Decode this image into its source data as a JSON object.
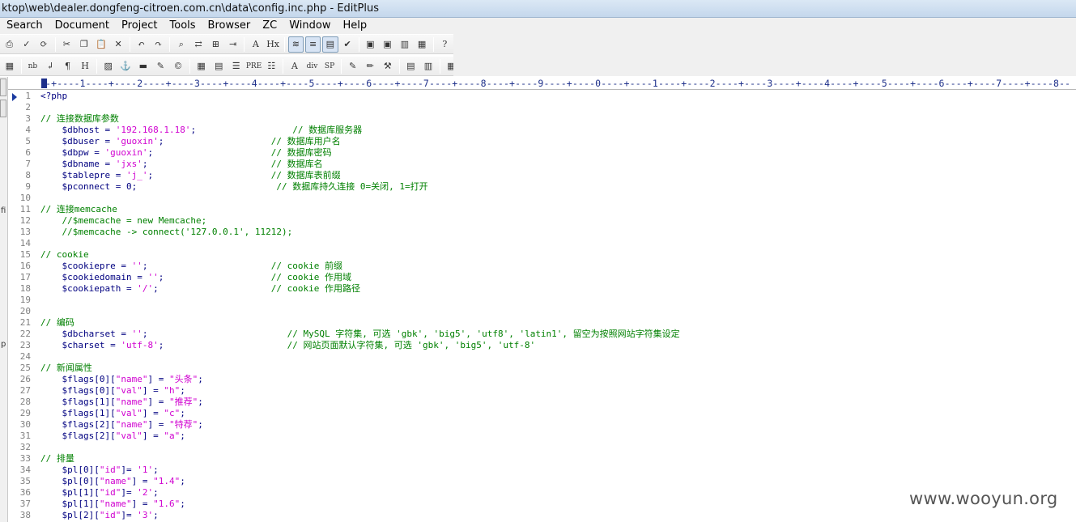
{
  "window": {
    "title": "ktop\\web\\dealer.dongfeng-citroen.com.cn\\data\\config.inc.php - EditPlus"
  },
  "menu": [
    "Search",
    "Document",
    "Project",
    "Tools",
    "Browser",
    "ZC",
    "Window",
    "Help"
  ],
  "toolbar1": [
    {
      "name": "print-icon",
      "glyph": "⎙"
    },
    {
      "name": "spellcheck-icon",
      "glyph": "✓"
    },
    {
      "name": "view-browser-icon",
      "glyph": "⟳"
    },
    {
      "name": "cut-icon",
      "glyph": "✂"
    },
    {
      "name": "copy-icon",
      "glyph": "❐"
    },
    {
      "name": "paste-icon",
      "glyph": "📋"
    },
    {
      "name": "delete-icon",
      "glyph": "✕"
    },
    {
      "name": "undo-icon",
      "glyph": "↶"
    },
    {
      "name": "redo-icon",
      "glyph": "↷"
    },
    {
      "name": "find-icon",
      "glyph": "⌕"
    },
    {
      "name": "replace-icon",
      "glyph": "⇄"
    },
    {
      "name": "find-in-files-icon",
      "glyph": "⊞"
    },
    {
      "name": "goto-icon",
      "glyph": "⇥"
    },
    {
      "name": "font-icon",
      "glyph": "A"
    },
    {
      "name": "hex-icon",
      "glyph": "Hx"
    },
    {
      "name": "word-wrap-icon",
      "glyph": "≋"
    },
    {
      "name": "line-number-icon",
      "glyph": "≡"
    },
    {
      "name": "ruler-icon",
      "glyph": "▤"
    },
    {
      "name": "check-icon",
      "glyph": "✔"
    },
    {
      "name": "window-icon",
      "glyph": "▣"
    },
    {
      "name": "window2-icon",
      "glyph": "▣"
    },
    {
      "name": "directory-icon",
      "glyph": "▥"
    },
    {
      "name": "cliptext-icon",
      "glyph": "▦"
    },
    {
      "name": "help-icon",
      "glyph": "?"
    }
  ],
  "toolbar2": [
    {
      "name": "color-icon",
      "glyph": "▦"
    },
    {
      "name": "nbsp-icon",
      "glyph": "nb"
    },
    {
      "name": "br-icon",
      "glyph": "↲"
    },
    {
      "name": "paragraph-icon",
      "glyph": "¶"
    },
    {
      "name": "heading-icon",
      "glyph": "H"
    },
    {
      "name": "image-icon",
      "glyph": "▨"
    },
    {
      "name": "anchor-icon",
      "glyph": "⚓"
    },
    {
      "name": "hr-icon",
      "glyph": "▬"
    },
    {
      "name": "highlight-icon",
      "glyph": "✎"
    },
    {
      "name": "copyright-icon",
      "glyph": "©"
    },
    {
      "name": "table-icon",
      "glyph": "▦"
    },
    {
      "name": "form-icon",
      "glyph": "▤"
    },
    {
      "name": "align-icon",
      "glyph": "☰"
    },
    {
      "name": "pre-icon",
      "glyph": "PRE"
    },
    {
      "name": "list-icon",
      "glyph": "☷"
    },
    {
      "name": "font-tag-icon",
      "glyph": "A"
    },
    {
      "name": "div-icon",
      "glyph": "div"
    },
    {
      "name": "span-icon",
      "glyph": "SP"
    },
    {
      "name": "edit-icon",
      "glyph": "✎"
    },
    {
      "name": "pencil-icon",
      "glyph": "✏"
    },
    {
      "name": "tools-icon",
      "glyph": "⚒"
    },
    {
      "name": "template-icon",
      "glyph": "▤"
    },
    {
      "name": "cliplib-icon",
      "glyph": "▥"
    },
    {
      "name": "palette-icon",
      "glyph": "▦"
    },
    {
      "name": "preview-icon",
      "glyph": "▣"
    }
  ],
  "ruler": "--+----1----+----2----+----3----+----4----+----5----+----6----+----7----+----8----+----9----+----0----+----1----+----2----+----3----+----4----+----5----+----6----+----7----+----8--",
  "code_lines": [
    {
      "n": "1",
      "parts": [
        {
          "t": "<?php",
          "c": "php"
        }
      ]
    },
    {
      "n": "2",
      "parts": []
    },
    {
      "n": "3",
      "parts": [
        {
          "t": "// 连接数据库参数",
          "c": "comment"
        }
      ]
    },
    {
      "n": "4",
      "parts": [
        {
          "t": "    $dbhost = ",
          "c": "var"
        },
        {
          "t": "'192.168.1.18'",
          "c": "str"
        },
        {
          "t": ";                  ",
          "c": "var"
        },
        {
          "t": "// 数据库服务器",
          "c": "comment"
        }
      ]
    },
    {
      "n": "5",
      "parts": [
        {
          "t": "    $dbuser = ",
          "c": "var"
        },
        {
          "t": "'guoxin'",
          "c": "str"
        },
        {
          "t": ";                    ",
          "c": "var"
        },
        {
          "t": "// 数据库用户名",
          "c": "comment"
        }
      ]
    },
    {
      "n": "6",
      "parts": [
        {
          "t": "    $dbpw = ",
          "c": "var"
        },
        {
          "t": "'guoxin'",
          "c": "str"
        },
        {
          "t": ";                      ",
          "c": "var"
        },
        {
          "t": "// 数据库密码",
          "c": "comment"
        }
      ]
    },
    {
      "n": "7",
      "parts": [
        {
          "t": "    $dbname = ",
          "c": "var"
        },
        {
          "t": "'jxs'",
          "c": "str"
        },
        {
          "t": ";                       ",
          "c": "var"
        },
        {
          "t": "// 数据库名",
          "c": "comment"
        }
      ]
    },
    {
      "n": "8",
      "parts": [
        {
          "t": "    $tablepre = ",
          "c": "var"
        },
        {
          "t": "'j_'",
          "c": "str"
        },
        {
          "t": ";                      ",
          "c": "var"
        },
        {
          "t": "// 数据库表前缀",
          "c": "comment"
        }
      ]
    },
    {
      "n": "9",
      "parts": [
        {
          "t": "    $pconnect = 0;                          ",
          "c": "var"
        },
        {
          "t": "// 数据库持久连接 0=关闭, 1=打开",
          "c": "comment"
        }
      ]
    },
    {
      "n": "10",
      "parts": []
    },
    {
      "n": "11",
      "parts": [
        {
          "t": "// 连接memcache",
          "c": "comment"
        }
      ]
    },
    {
      "n": "12",
      "parts": [
        {
          "t": "    //$memcache = new Memcache;",
          "c": "comment"
        }
      ]
    },
    {
      "n": "13",
      "parts": [
        {
          "t": "    //$memcache -> connect('127.0.0.1', 11212);",
          "c": "comment"
        }
      ]
    },
    {
      "n": "14",
      "parts": []
    },
    {
      "n": "15",
      "parts": [
        {
          "t": "// cookie",
          "c": "comment"
        }
      ]
    },
    {
      "n": "16",
      "parts": [
        {
          "t": "    $cookiepre = ",
          "c": "var"
        },
        {
          "t": "''",
          "c": "str"
        },
        {
          "t": ";                       ",
          "c": "var"
        },
        {
          "t": "// cookie 前缀",
          "c": "comment"
        }
      ]
    },
    {
      "n": "17",
      "parts": [
        {
          "t": "    $cookiedomain = ",
          "c": "var"
        },
        {
          "t": "''",
          "c": "str"
        },
        {
          "t": ";                    ",
          "c": "var"
        },
        {
          "t": "// cookie 作用域",
          "c": "comment"
        }
      ]
    },
    {
      "n": "18",
      "parts": [
        {
          "t": "    $cookiepath = ",
          "c": "var"
        },
        {
          "t": "'/'",
          "c": "str"
        },
        {
          "t": ";                     ",
          "c": "var"
        },
        {
          "t": "// cookie 作用路径",
          "c": "comment"
        }
      ]
    },
    {
      "n": "19",
      "parts": []
    },
    {
      "n": "20",
      "parts": []
    },
    {
      "n": "21",
      "parts": [
        {
          "t": "// 编码",
          "c": "comment"
        }
      ]
    },
    {
      "n": "22",
      "parts": [
        {
          "t": "    $dbcharset = ",
          "c": "var"
        },
        {
          "t": "''",
          "c": "str"
        },
        {
          "t": ";                          ",
          "c": "var"
        },
        {
          "t": "// MySQL 字符集, 可选 'gbk', 'big5', 'utf8', 'latin1', 留空为按照网站字符集设定",
          "c": "comment"
        }
      ]
    },
    {
      "n": "23",
      "parts": [
        {
          "t": "    $charset = ",
          "c": "var"
        },
        {
          "t": "'utf-8'",
          "c": "str"
        },
        {
          "t": ";                       ",
          "c": "var"
        },
        {
          "t": "// 网站页面默认字符集, 可选 'gbk', 'big5', 'utf-8'",
          "c": "comment"
        }
      ]
    },
    {
      "n": "24",
      "parts": []
    },
    {
      "n": "25",
      "parts": [
        {
          "t": "// 新闻属性",
          "c": "comment"
        }
      ]
    },
    {
      "n": "26",
      "parts": [
        {
          "t": "    $flags[0][",
          "c": "var"
        },
        {
          "t": "\"name\"",
          "c": "str"
        },
        {
          "t": "] = ",
          "c": "var"
        },
        {
          "t": "\"头条\"",
          "c": "str"
        },
        {
          "t": ";",
          "c": "var"
        }
      ]
    },
    {
      "n": "27",
      "parts": [
        {
          "t": "    $flags[0][",
          "c": "var"
        },
        {
          "t": "\"val\"",
          "c": "str"
        },
        {
          "t": "] = ",
          "c": "var"
        },
        {
          "t": "\"h\"",
          "c": "str"
        },
        {
          "t": ";",
          "c": "var"
        }
      ]
    },
    {
      "n": "28",
      "parts": [
        {
          "t": "    $flags[1][",
          "c": "var"
        },
        {
          "t": "\"name\"",
          "c": "str"
        },
        {
          "t": "] = ",
          "c": "var"
        },
        {
          "t": "\"推荐\"",
          "c": "str"
        },
        {
          "t": ";",
          "c": "var"
        }
      ]
    },
    {
      "n": "29",
      "parts": [
        {
          "t": "    $flags[1][",
          "c": "var"
        },
        {
          "t": "\"val\"",
          "c": "str"
        },
        {
          "t": "] = ",
          "c": "var"
        },
        {
          "t": "\"c\"",
          "c": "str"
        },
        {
          "t": ";",
          "c": "var"
        }
      ]
    },
    {
      "n": "30",
      "parts": [
        {
          "t": "    $flags[2][",
          "c": "var"
        },
        {
          "t": "\"name\"",
          "c": "str"
        },
        {
          "t": "] = ",
          "c": "var"
        },
        {
          "t": "\"特荐\"",
          "c": "str"
        },
        {
          "t": ";",
          "c": "var"
        }
      ]
    },
    {
      "n": "31",
      "parts": [
        {
          "t": "    $flags[2][",
          "c": "var"
        },
        {
          "t": "\"val\"",
          "c": "str"
        },
        {
          "t": "] = ",
          "c": "var"
        },
        {
          "t": "\"a\"",
          "c": "str"
        },
        {
          "t": ";",
          "c": "var"
        }
      ]
    },
    {
      "n": "32",
      "parts": []
    },
    {
      "n": "33",
      "parts": [
        {
          "t": "// 排量",
          "c": "comment"
        }
      ]
    },
    {
      "n": "34",
      "parts": [
        {
          "t": "    $pl[0][",
          "c": "var"
        },
        {
          "t": "\"id\"",
          "c": "str"
        },
        {
          "t": "]= ",
          "c": "var"
        },
        {
          "t": "'1'",
          "c": "str"
        },
        {
          "t": ";",
          "c": "var"
        }
      ]
    },
    {
      "n": "35",
      "parts": [
        {
          "t": "    $pl[0][",
          "c": "var"
        },
        {
          "t": "\"name\"",
          "c": "str"
        },
        {
          "t": "] = ",
          "c": "var"
        },
        {
          "t": "\"1.4\"",
          "c": "str"
        },
        {
          "t": ";",
          "c": "var"
        }
      ]
    },
    {
      "n": "36",
      "parts": [
        {
          "t": "    $pl[1][",
          "c": "var"
        },
        {
          "t": "\"id\"",
          "c": "str"
        },
        {
          "t": "]= ",
          "c": "var"
        },
        {
          "t": "'2'",
          "c": "str"
        },
        {
          "t": ";",
          "c": "var"
        }
      ]
    },
    {
      "n": "37",
      "parts": [
        {
          "t": "    $pl[1][",
          "c": "var"
        },
        {
          "t": "\"name\"",
          "c": "str"
        },
        {
          "t": "] = ",
          "c": "var"
        },
        {
          "t": "\"1.6\"",
          "c": "str"
        },
        {
          "t": ";",
          "c": "var"
        }
      ]
    },
    {
      "n": "38",
      "parts": [
        {
          "t": "    $pl[2][",
          "c": "var"
        },
        {
          "t": "\"id\"",
          "c": "str"
        },
        {
          "t": "]= ",
          "c": "var"
        },
        {
          "t": "'3'",
          "c": "str"
        },
        {
          "t": ";",
          "c": "var"
        }
      ]
    }
  ],
  "left_strip_letters": [
    "fi",
    "p"
  ],
  "watermark": "www.wooyun.org",
  "colors": {
    "comment": "#008000",
    "string": "#d000d0",
    "code": "#000080",
    "ruler": "#1d2f8a",
    "line_number": "#808080"
  }
}
